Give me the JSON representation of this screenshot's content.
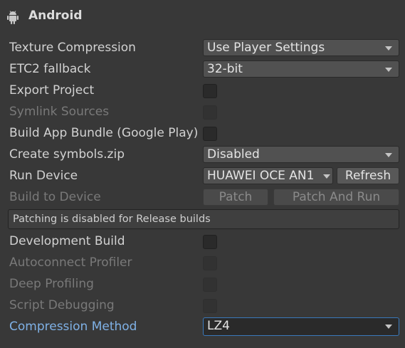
{
  "header": {
    "icon": "android-icon",
    "title": "Android"
  },
  "settings": {
    "texture_compression": {
      "label": "Texture Compression",
      "value": "Use Player Settings"
    },
    "etc2_fallback": {
      "label": "ETC2 fallback",
      "value": "32-bit"
    },
    "export_project": {
      "label": "Export Project",
      "checked": false
    },
    "symlink_sources": {
      "label": "Symlink Sources",
      "checked": false,
      "disabled": true
    },
    "build_app_bundle": {
      "label": "Build App Bundle (Google Play)",
      "checked": false
    },
    "create_symbols": {
      "label": "Create symbols.zip",
      "value": "Disabled"
    },
    "run_device": {
      "label": "Run Device",
      "value": "HUAWEI OCE AN1",
      "refresh_label": "Refresh"
    },
    "build_to_device": {
      "label": "Build to Device",
      "patch_label": "Patch",
      "patch_and_run_label": "Patch And Run"
    },
    "info_message": "Patching is disabled for Release builds",
    "development_build": {
      "label": "Development Build",
      "checked": false
    },
    "autoconnect_profiler": {
      "label": "Autoconnect Profiler",
      "checked": false,
      "disabled": true
    },
    "deep_profiling": {
      "label": "Deep Profiling",
      "checked": false,
      "disabled": true
    },
    "script_debugging": {
      "label": "Script Debugging",
      "checked": false,
      "disabled": true
    },
    "compression_method": {
      "label": "Compression Method",
      "value": "LZ4"
    }
  },
  "colors": {
    "background": "#383838",
    "text": "#d2d2d2",
    "disabled_text": "#797979",
    "active_label": "#7fb1e6",
    "focus_border": "#3a79bb"
  }
}
